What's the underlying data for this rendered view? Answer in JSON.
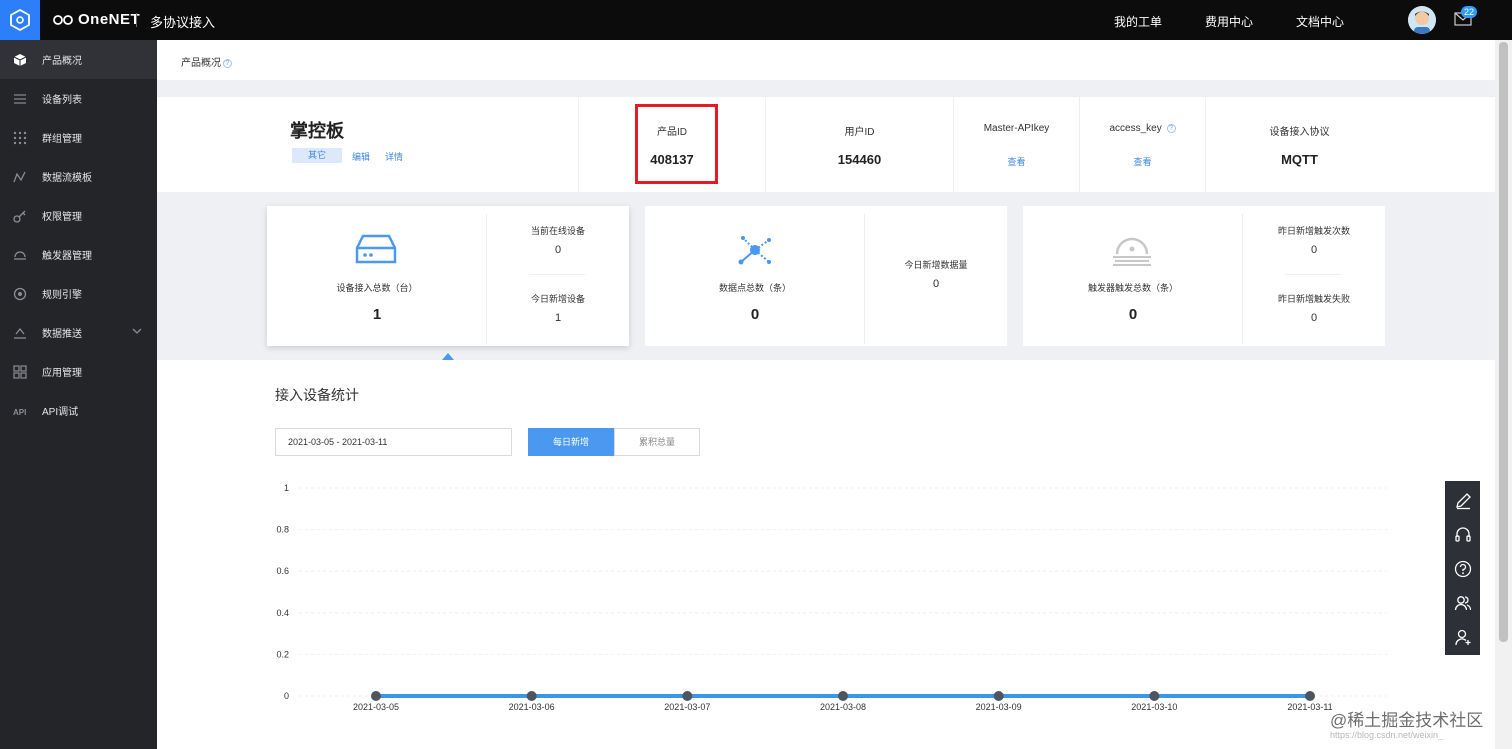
{
  "header": {
    "brand": "OneNET",
    "app_title": "多协议接入",
    "nav": [
      "我的工单",
      "费用中心",
      "文档中心"
    ],
    "mail_badge": "22"
  },
  "sidebar": {
    "items": [
      {
        "label": "产品概况",
        "icon": "cube-icon",
        "active": true
      },
      {
        "label": "设备列表",
        "icon": "list-icon"
      },
      {
        "label": "群组管理",
        "icon": "grid-dots-icon"
      },
      {
        "label": "数据流模板",
        "icon": "stream-icon"
      },
      {
        "label": "权限管理",
        "icon": "key-icon"
      },
      {
        "label": "触发器管理",
        "icon": "trigger-icon"
      },
      {
        "label": "规则引擎",
        "icon": "engine-icon"
      },
      {
        "label": "数据推送",
        "icon": "push-icon",
        "expandable": true
      },
      {
        "label": "应用管理",
        "icon": "apps-icon"
      },
      {
        "label": "API调试",
        "icon": "api-icon"
      }
    ]
  },
  "breadcrumb": {
    "label": "产品概况",
    "help": "?"
  },
  "product": {
    "name": "掌控板",
    "tag": "其它",
    "edit_link": "编辑",
    "detail_link": "详情",
    "fields": [
      {
        "key": "产品ID",
        "value": "408137"
      },
      {
        "key": "用户ID",
        "value": "154460"
      },
      {
        "key": "Master-APIkey",
        "link": "查看"
      },
      {
        "key": "access_key",
        "link": "查看",
        "help": "?"
      },
      {
        "key": "设备接入协议",
        "value": "MQTT"
      }
    ]
  },
  "stats": {
    "devices": {
      "main_label": "设备接入总数（台）",
      "main_value": "1",
      "online_label": "当前在线设备",
      "online_value": "0",
      "new_label": "今日新增设备",
      "new_value": "1"
    },
    "datapoints": {
      "main_label": "数据点总数（条）",
      "main_value": "0",
      "new_label": "今日新增数据量",
      "new_value": "0"
    },
    "triggers": {
      "main_label": "触发器触发总数（条）",
      "main_value": "0",
      "y_count_label": "昨日新增触发次数",
      "y_count_value": "0",
      "y_fail_label": "昨日新增触发失败",
      "y_fail_value": "0"
    }
  },
  "device_stats": {
    "title": "接入设备统计",
    "date_range": "2021-03-05 - 2021-03-11",
    "toggle_daily": "每日新增",
    "toggle_cumulative": "累积总量"
  },
  "chart_data": {
    "type": "line",
    "x": [
      "2021-03-05",
      "2021-03-06",
      "2021-03-07",
      "2021-03-08",
      "2021-03-09",
      "2021-03-10",
      "2021-03-11"
    ],
    "series": [
      {
        "values": [
          0,
          0,
          0,
          0,
          0,
          0,
          0
        ]
      }
    ],
    "yticks": [
      "0",
      "0.2",
      "0.4",
      "0.6",
      "0.8",
      "1"
    ],
    "ylim": [
      0,
      1
    ],
    "grid": true,
    "line_color": "#3c96e6"
  },
  "watermark": "@稀土掘金技术社区",
  "watermark_url": "https://blog.csdn.net/weixin_"
}
